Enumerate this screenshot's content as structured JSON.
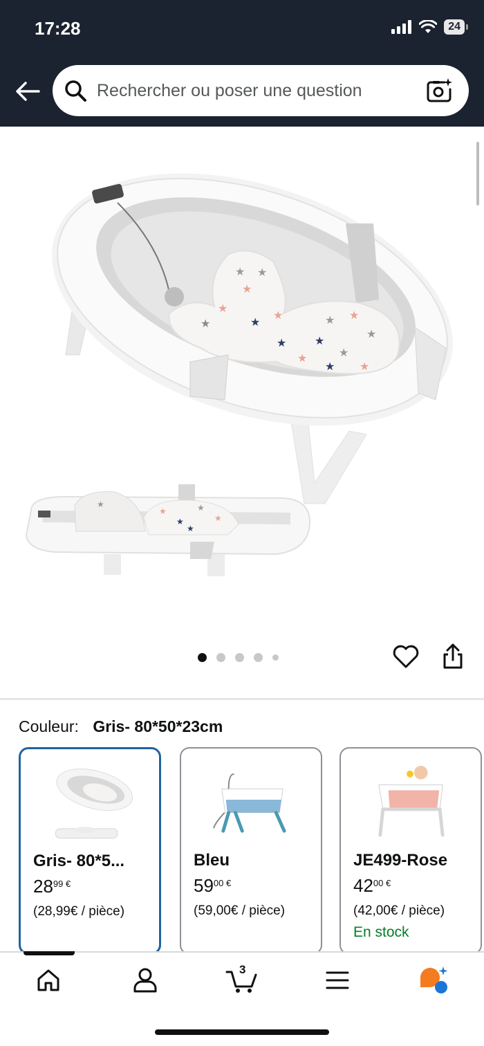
{
  "status_bar": {
    "time": "17:28",
    "battery": "24"
  },
  "search": {
    "placeholder": "Rechercher ou poser une question"
  },
  "gallery": {
    "image_count": 5,
    "active_index": 0
  },
  "color_selector": {
    "label": "Couleur:",
    "selected_value": "Gris- 80*50*23cm",
    "variants": [
      {
        "name": "Gris- 80*5...",
        "price_whole": "28",
        "price_fraction": "99",
        "currency": "€",
        "unit_price": "(28,99€ / pièce)",
        "stock": "",
        "selected": true
      },
      {
        "name": "Bleu",
        "price_whole": "59",
        "price_fraction": "00",
        "currency": "€",
        "unit_price": "(59,00€ / pièce)",
        "stock": "",
        "selected": false
      },
      {
        "name": "JE499-Rose",
        "price_whole": "42",
        "price_fraction": "00",
        "currency": "€",
        "unit_price": "(42,00€ / pièce)",
        "stock": "En stock",
        "selected": false
      }
    ]
  },
  "bottom_nav": {
    "items": [
      "home-icon",
      "account-icon",
      "cart-icon",
      "menu-icon",
      "rufus-icon"
    ],
    "cart_count": "3"
  },
  "colors": {
    "header": "#1b2230",
    "selected_border": "#2162a1",
    "in_stock": "#067d28"
  }
}
